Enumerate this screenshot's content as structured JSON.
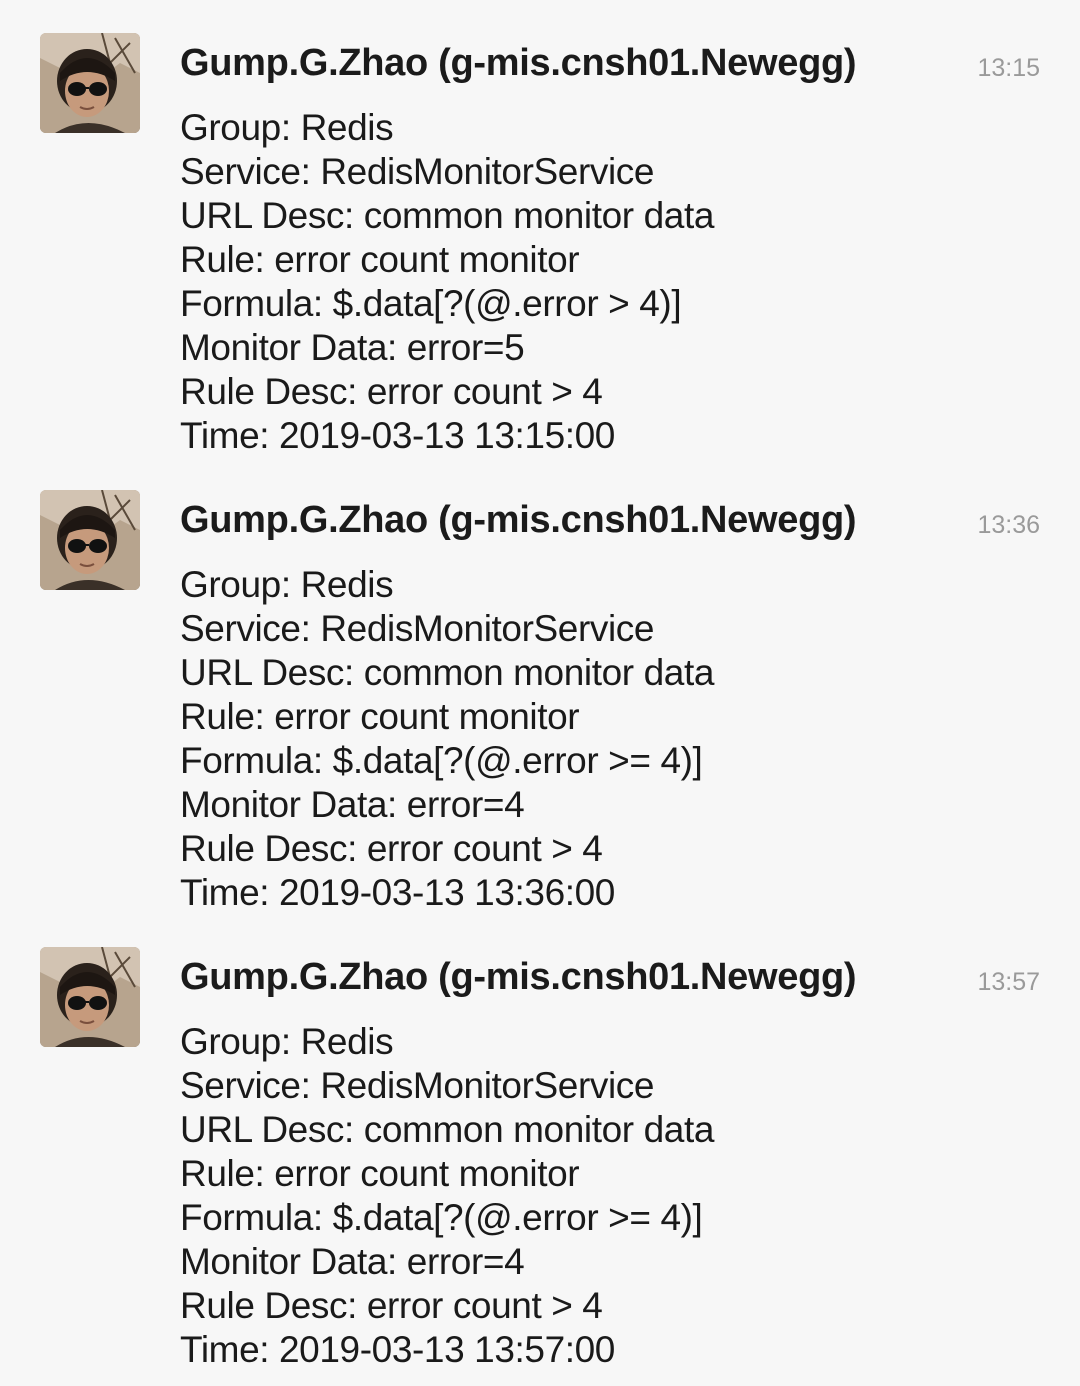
{
  "messages": [
    {
      "sender": "Gump.G.Zhao (g-mis.cnsh01.Newegg)",
      "time": "13:15",
      "avatar_icon": "user-avatar-photo",
      "lines": [
        "Group: Redis",
        "Service: RedisMonitorService",
        "URL Desc: common monitor data",
        "Rule: error count monitor",
        "Formula: $.data[?(@.error > 4)]",
        "Monitor Data: error=5",
        "Rule Desc: error count > 4",
        "Time: 2019-03-13 13:15:00"
      ]
    },
    {
      "sender": "Gump.G.Zhao (g-mis.cnsh01.Newegg)",
      "time": "13:36",
      "avatar_icon": "user-avatar-photo",
      "lines": [
        "Group: Redis",
        "Service: RedisMonitorService",
        "URL Desc: common monitor data",
        "Rule: error count monitor",
        "Formula: $.data[?(@.error >= 4)]",
        "Monitor Data: error=4",
        "Rule Desc: error count > 4",
        "Time: 2019-03-13 13:36:00"
      ]
    },
    {
      "sender": "Gump.G.Zhao (g-mis.cnsh01.Newegg)",
      "time": "13:57",
      "avatar_icon": "user-avatar-photo",
      "lines": [
        "Group: Redis",
        "Service: RedisMonitorService",
        "URL Desc: common monitor data",
        "Rule: error count monitor",
        "Formula: $.data[?(@.error >= 4)]",
        "Monitor Data: error=4",
        "Rule Desc: error count > 4",
        "Time: 2019-03-13 13:57:00"
      ]
    }
  ],
  "colors": {
    "background": "#f7f7f7",
    "sender_text": "#1b1b1b",
    "body_text": "#1a1a1a",
    "timestamp_text": "#9a9a9a"
  }
}
